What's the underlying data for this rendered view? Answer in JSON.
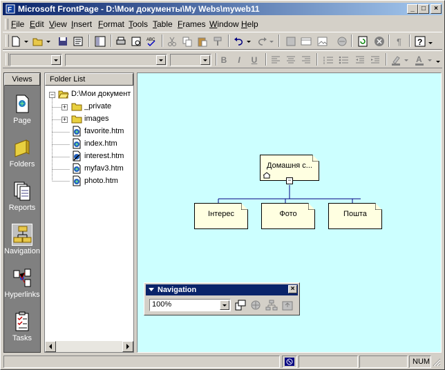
{
  "window": {
    "title": "Microsoft FrontPage - D:\\Мои документы\\My Webs\\myweb11",
    "minimize": "_",
    "maximize": "□",
    "close": "×"
  },
  "menu": [
    {
      "label": "File",
      "key": "F",
      "rest": "ile"
    },
    {
      "label": "Edit",
      "key": "E",
      "rest": "dit"
    },
    {
      "label": "View",
      "key": "V",
      "rest": "iew"
    },
    {
      "label": "Insert",
      "key": "I",
      "rest": "nsert"
    },
    {
      "label": "Format",
      "key": "F",
      "rest": "ormat"
    },
    {
      "label": "Tools",
      "key": "T",
      "rest": "ools"
    },
    {
      "label": "Table",
      "key": "T",
      "rest": "able"
    },
    {
      "label": "Frames",
      "key": "F",
      "rest": "rames"
    },
    {
      "label": "Window",
      "key": "W",
      "rest": "indow"
    },
    {
      "label": "Help",
      "key": "H",
      "rest": "elp"
    }
  ],
  "formatting": {
    "bold": "B",
    "italic": "I",
    "underline": "U"
  },
  "views": {
    "header": "Views",
    "items": [
      {
        "label": "Page",
        "icon": "page-view-icon"
      },
      {
        "label": "Folders",
        "icon": "folders-view-icon"
      },
      {
        "label": "Reports",
        "icon": "reports-view-icon"
      },
      {
        "label": "Navigation",
        "icon": "navigation-view-icon"
      },
      {
        "label": "Hyperlinks",
        "icon": "hyperlinks-view-icon"
      },
      {
        "label": "Tasks",
        "icon": "tasks-view-icon"
      }
    ],
    "active": "Navigation"
  },
  "folder_list": {
    "header": "Folder List",
    "root": "D:\\Мои документ",
    "items": [
      {
        "label": "_private",
        "type": "folder"
      },
      {
        "label": "images",
        "type": "folder"
      },
      {
        "label": "favorite.htm",
        "type": "page"
      },
      {
        "label": "index.htm",
        "type": "page"
      },
      {
        "label": "interest.htm",
        "type": "page-edit"
      },
      {
        "label": "myfav3.htm",
        "type": "page"
      },
      {
        "label": "photo.htm",
        "type": "page"
      }
    ]
  },
  "navigation": {
    "home": "Домашня с...",
    "children": [
      "Інтерес",
      "Фото",
      "Пошта"
    ]
  },
  "nav_toolbar": {
    "title": "Navigation",
    "zoom": "100%"
  },
  "status": {
    "num": "NUM"
  },
  "colors": {
    "title_start": "#0a246a",
    "title_end": "#a6caf0",
    "nav_bg": "#ccffff",
    "node_bg": "#ffffe1"
  }
}
